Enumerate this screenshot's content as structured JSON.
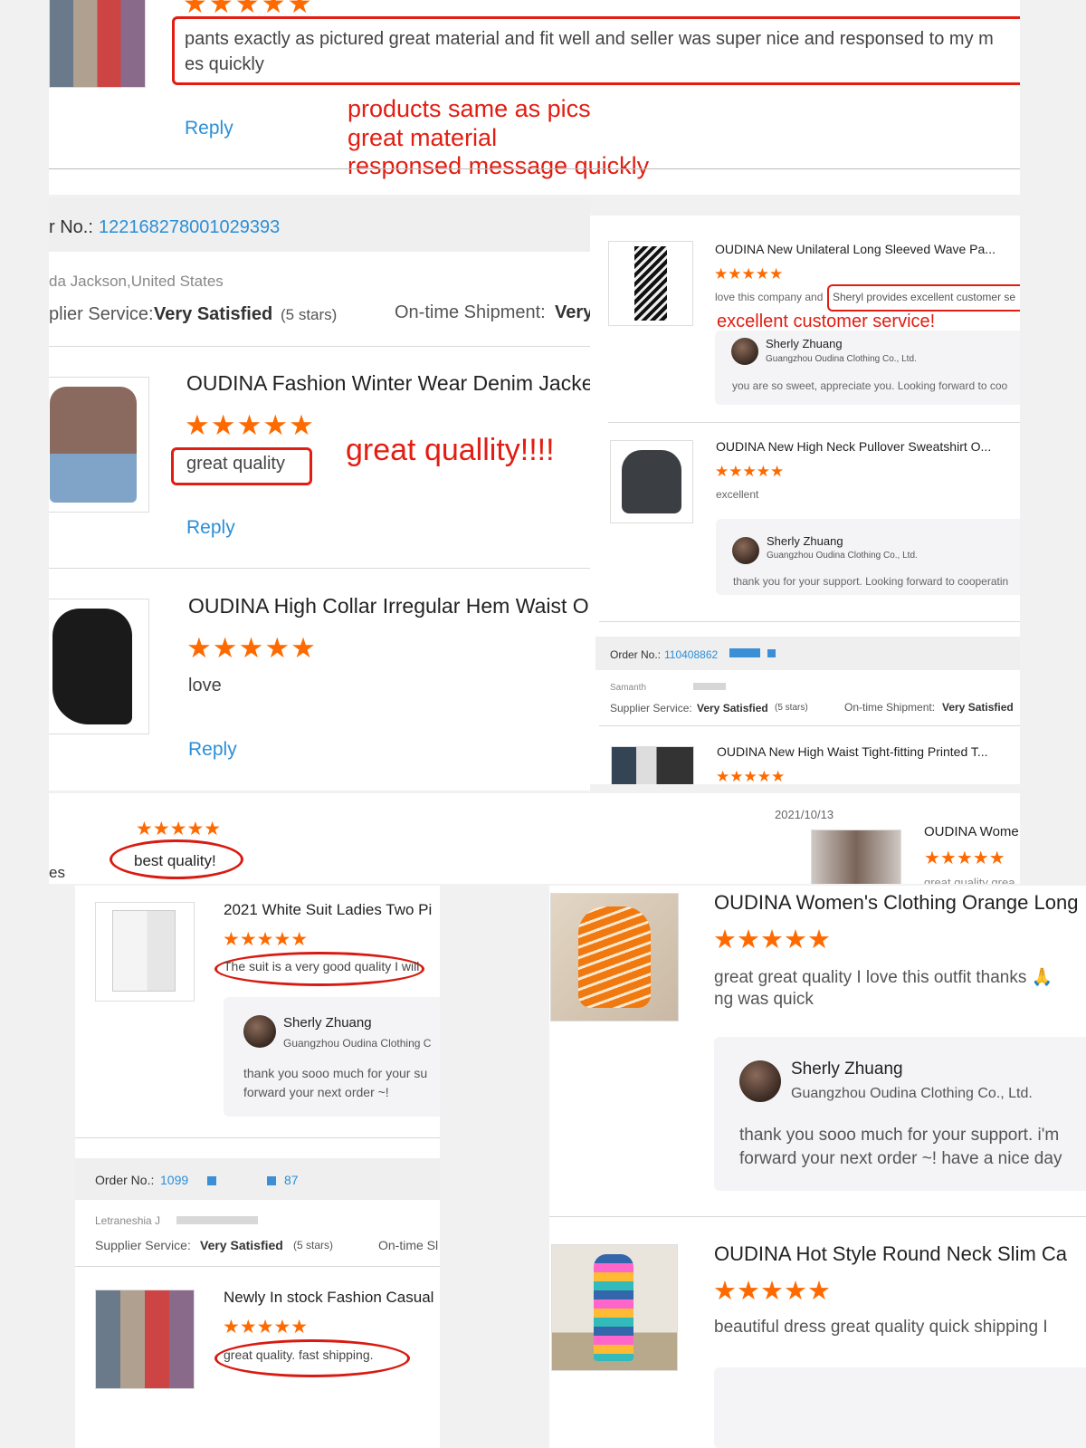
{
  "top_review": {
    "text_line1": "pants exactly as pictured great material and fit well and seller was super nice and responsed to my m",
    "text_line2": "es quickly",
    "reply": "Reply",
    "annotation": [
      "products same as pics",
      "great material",
      "responsed message quickly"
    ]
  },
  "left_order": {
    "order_label": "r No.:",
    "order_number": "122168278001029393",
    "buyer": "da Jackson,United States",
    "supplier_label": "plier Service:",
    "supplier_value": "Very Satisfied",
    "supplier_stars": "(5 stars)",
    "shipment_label": "On-time Shipment:",
    "shipment_value": "Very"
  },
  "left_products": [
    {
      "title": "OUDINA Fashion Winter Wear Denim Jacke",
      "comment": "great quality",
      "reply": "Reply",
      "annotation": "great quallity!!!!"
    },
    {
      "title": "OUDINA High Collar Irregular Hem Waist O",
      "comment": "love",
      "reply": "Reply"
    }
  ],
  "right_panel": {
    "items": [
      {
        "title": "OUDINA New Unilateral Long Sleeved Wave Pa...",
        "comment_prefix": "love this company and",
        "comment_highlight": "Sheryl provides excellent customer se",
        "annotation": "excellent customer service!",
        "reply_name": "Sherly Zhuang",
        "reply_company": "Guangzhou Oudina Clothing Co., Ltd.",
        "reply_text": "you are so sweet, appreciate you. Looking forward to coo"
      },
      {
        "title": "OUDINA New High Neck Pullover Sweatshirt O...",
        "comment": "excellent",
        "reply_name": "Sherly Zhuang",
        "reply_company": "Guangzhou Oudina Clothing Co., Ltd.",
        "reply_text": "thank you for your support. Looking forward to cooperatin"
      }
    ],
    "order_label": "Order No.:",
    "order_number": "110408862",
    "buyer": "Samanth",
    "supplier_label": "Supplier Service:",
    "supplier_value": "Very Satisfied",
    "supplier_stars": "(5 stars)",
    "shipment_label": "On-time Shipment:",
    "shipment_value": "Very Satisfied",
    "item3_title": "OUDINA New High Waist Tight-fitting Printed T..."
  },
  "middle": {
    "comment": "best quality!",
    "fragment_left": "es",
    "date": "2021/10/13",
    "snippet_title": "OUDINA Wome",
    "snippet_comment": "great quality grea"
  },
  "bottom_left": {
    "title": "2021 White Suit Ladies Two Pi",
    "comment": "The suit is a very good quality I will",
    "reply_name": "Sherly Zhuang",
    "reply_company": "Guangzhou Oudina Clothing C",
    "reply_text_line1": "thank you sooo much for your su",
    "reply_text_line2": "forward your next order ~!",
    "order_label": "Order No.:",
    "order_number_start": "1099",
    "order_number_end": "87",
    "buyer": "Letraneshia J",
    "supplier_label": "Supplier Service:",
    "supplier_value": "Very Satisfied",
    "supplier_stars": "(5 stars)",
    "shipment_label": "On-time Sl",
    "item2_title": "Newly In stock Fashion Casual",
    "item2_comment": "great quality. fast shipping."
  },
  "bottom_right": {
    "title": "OUDINA Women's Clothing Orange Long",
    "comment_line1": "great great quality I love this outfit thanks 🙏",
    "comment_line2": "ng was quick",
    "reply_name": "Sherly Zhuang",
    "reply_company": "Guangzhou Oudina Clothing Co., Ltd.",
    "reply_text_line1": "thank you sooo much for your support. i'm",
    "reply_text_line2": "forward your next order ~! have a nice day",
    "item2_title": "OUDINA Hot Style Round Neck Slim Ca",
    "item2_comment": "beautiful dress great quality quick shipping I"
  },
  "stars_glyph": "★★★★★",
  "colors": {
    "accent_orange": "#ff6a00",
    "link_blue": "#2a8fd8",
    "annotation_red": "#e21d12"
  }
}
